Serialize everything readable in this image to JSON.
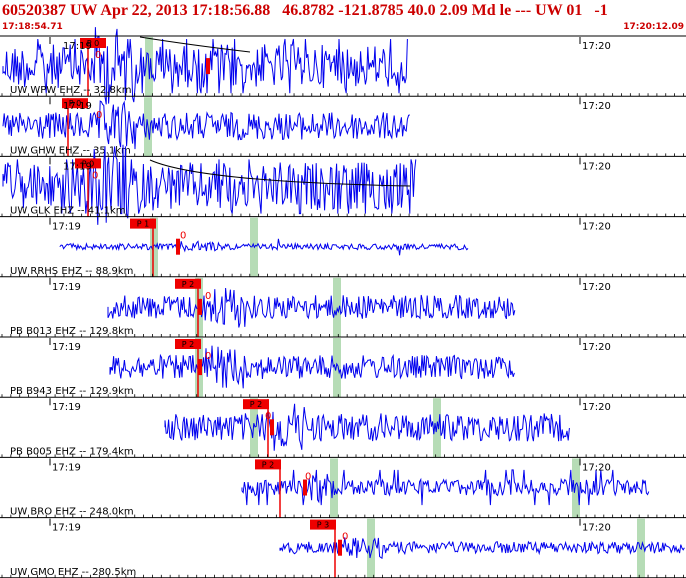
{
  "header": {
    "title": "60520387 UW Apr 22, 2013 17:18:56.88   46.8782 -121.8785 40.0 2.09 Md le --- UW 01   -1",
    "start_time": "17:18:54.71",
    "end_time": "17:20:12.09"
  },
  "colors": {
    "trace": "#0000ee",
    "pick": "#ee0000",
    "grid": "#000000",
    "shade": "#b6dcb6",
    "text_red": "#cc0000"
  },
  "tick_labels": {
    "t1719": "17:19",
    "t1720": "17:20"
  },
  "stations": [
    {
      "label": "UW WPW EHZ -- 32.8km",
      "phase": "P 0",
      "onset": "0",
      "start_time": "17:19"
    },
    {
      "label": "UW GHW EHZ -- 35.1km",
      "phase": "P 0",
      "onset": "0",
      "start_time": "17:19"
    },
    {
      "label": "UW GLK EHZ -- 41.1km",
      "phase": "P 0",
      "onset": "0",
      "start_time": "17:19"
    },
    {
      "label": "UW RRHS EHZ -- 88.9km",
      "phase": "P 1",
      "onset": "0",
      "start_time": "17:19"
    },
    {
      "label": "PB B013 EHZ -- 129.8km",
      "phase": "P 2",
      "onset": "0",
      "start_time": "17:19"
    },
    {
      "label": "PB B943 EHZ -- 129.9km",
      "phase": "P 2",
      "onset": "0",
      "start_time": "17:19"
    },
    {
      "label": "PB B005 EHZ -- 179.4km",
      "phase": "P 2",
      "onset": "0",
      "start_time": "17:19"
    },
    {
      "label": "UW BRO EHZ -- 248.0km",
      "phase": "P 2",
      "onset": "0",
      "start_time": "17:19"
    },
    {
      "label": "UW GMO EHZ -- 280.5km",
      "phase": "P 3",
      "onset": "0",
      "start_time": "17:19"
    }
  ]
}
